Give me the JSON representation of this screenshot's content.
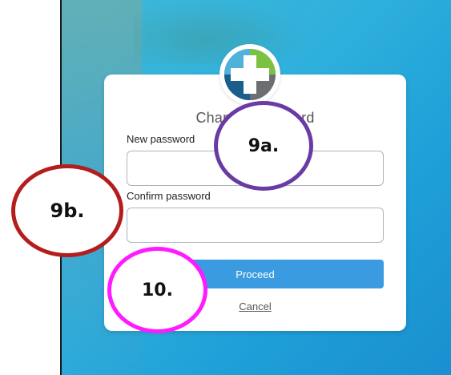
{
  "dialog": {
    "title": "Change password",
    "new_password_label": "New password",
    "confirm_password_label": "Confirm password",
    "proceed_label": "Proceed",
    "cancel_label": "Cancel"
  },
  "annotations": {
    "a9": "9a.",
    "b9": "9b.",
    "c10": "10."
  },
  "colors": {
    "background_blue": "#1e9fd8",
    "button_blue": "#3a9be0",
    "callout_9a": "#6a3aa5",
    "callout_9b": "#b31d1d",
    "callout_10": "#ff1aff"
  }
}
